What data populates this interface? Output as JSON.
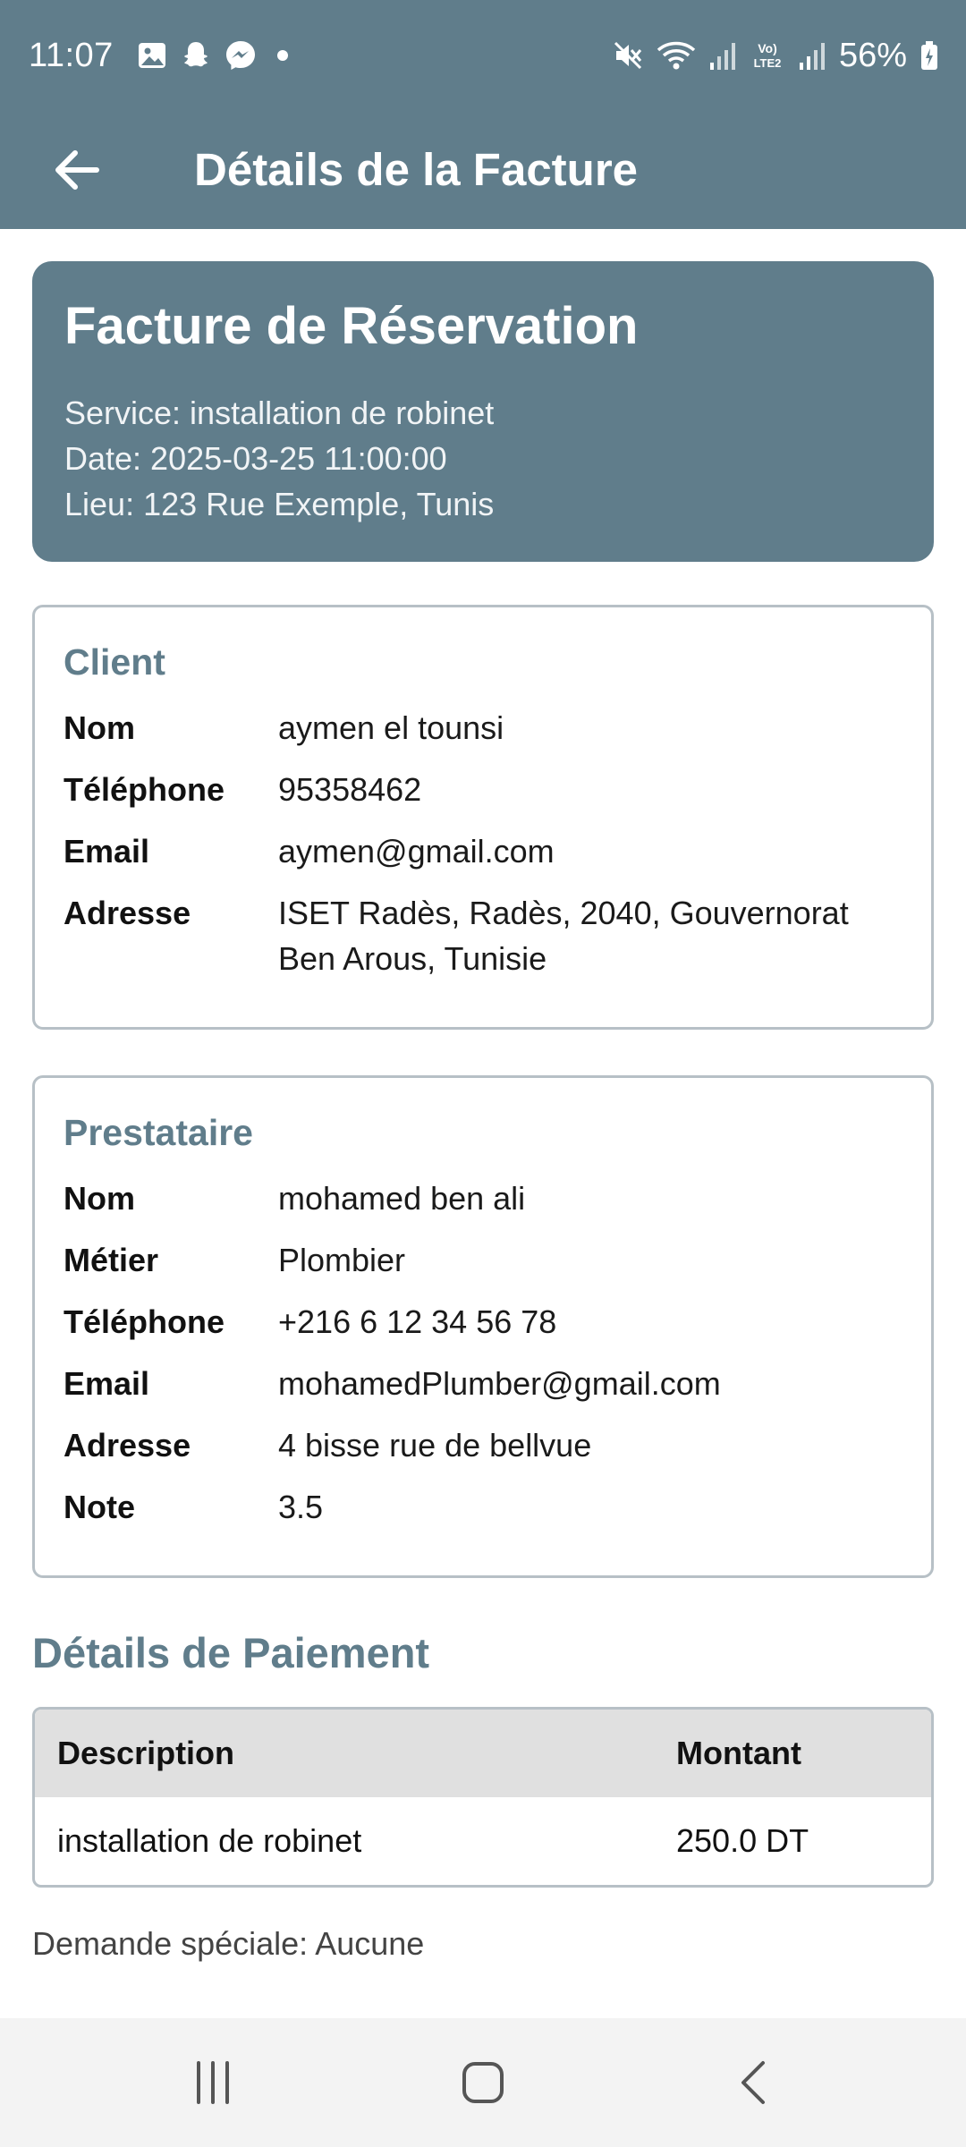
{
  "status_bar": {
    "time": "11:07",
    "battery": "56%",
    "left_icons": [
      "gallery-icon",
      "snapchat-icon",
      "messenger-icon",
      "dot-icon"
    ],
    "right_icons": [
      "mute-icon",
      "wifi-icon",
      "signal-icon",
      "volte-icon",
      "signal-icon",
      "battery-icon"
    ],
    "volte_label": "Vo) LTE2"
  },
  "app_bar": {
    "title": "Détails de la Facture",
    "back_icon": "arrow-left-icon"
  },
  "hero": {
    "title": "Facture de Réservation",
    "service": "Service: installation de robinet",
    "date": "Date: 2025-03-25 11:00:00",
    "place": "Lieu: 123 Rue Exemple, Tunis"
  },
  "client": {
    "title": "Client",
    "rows": [
      {
        "label": "Nom",
        "value": "aymen el tounsi"
      },
      {
        "label": "Téléphone",
        "value": "95358462"
      },
      {
        "label": "Email",
        "value": "aymen@gmail.com"
      },
      {
        "label": "Adresse",
        "value": "ISET Radès, Radès, 2040, Gouvernorat Ben Arous, Tunisie"
      }
    ]
  },
  "provider": {
    "title": "Prestataire",
    "rows": [
      {
        "label": "Nom",
        "value": "mohamed ben ali"
      },
      {
        "label": "Métier",
        "value": "Plombier"
      },
      {
        "label": "Téléphone",
        "value": "+216 6 12 34 56 78"
      },
      {
        "label": "Email",
        "value": "mohamedPlumber@gmail.com"
      },
      {
        "label": "Adresse",
        "value": "4 bisse rue de bellvue"
      },
      {
        "label": "Note",
        "value": "3.5"
      }
    ]
  },
  "payment": {
    "title": "Détails de Paiement",
    "headers": {
      "description": "Description",
      "amount": "Montant"
    },
    "rows": [
      {
        "description": "installation de robinet",
        "amount": "250.0 DT"
      }
    ],
    "special_request": "Demande spéciale: Aucune"
  },
  "nav_bar": {
    "icons": [
      "recent-apps-icon",
      "home-icon",
      "back-icon"
    ]
  },
  "colors": {
    "primary": "#607d8b",
    "table_header": "#e0e0e0",
    "border": "#b7c0c6",
    "nav_bg": "#f3f3f3"
  }
}
